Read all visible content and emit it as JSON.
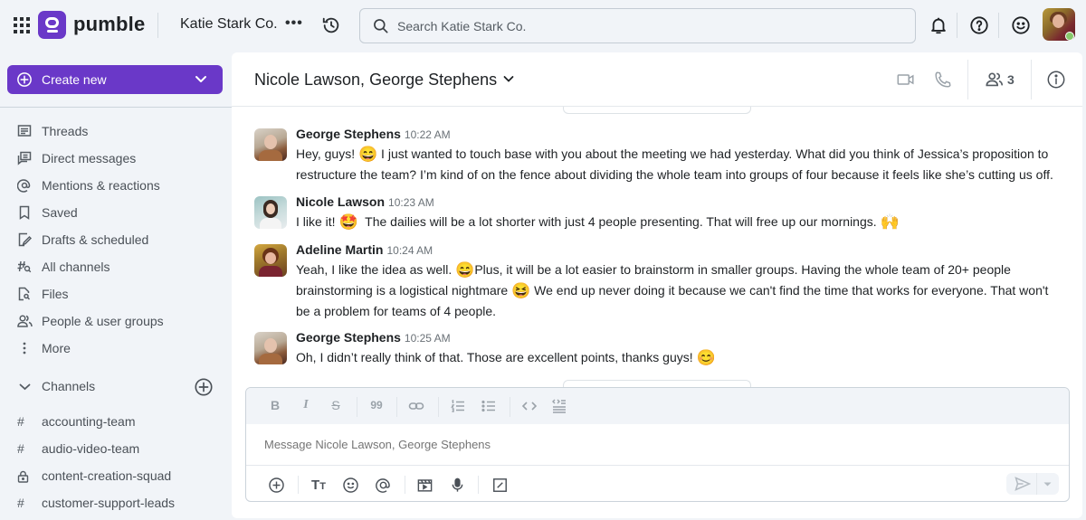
{
  "topbar": {
    "brand": "pumble",
    "workspace_name": "Katie Stark Co.",
    "more_label": "•••",
    "search_placeholder": "Search Katie Stark Co.",
    "icons": [
      "apps-grid-icon",
      "history-icon",
      "search-icon",
      "bell-icon",
      "help-icon",
      "emoji-status-icon"
    ],
    "user_status": "online",
    "brand_color": "#6a38c8"
  },
  "sidebar": {
    "create_new_label": "Create new",
    "nav_items": [
      {
        "label": "Threads",
        "icon": "threads-icon"
      },
      {
        "label": "Direct messages",
        "icon": "direct-messages-icon"
      },
      {
        "label": "Mentions & reactions",
        "icon": "at-icon"
      },
      {
        "label": "Saved",
        "icon": "bookmark-icon"
      },
      {
        "label": "Drafts & scheduled",
        "icon": "draft-icon"
      },
      {
        "label": "All channels",
        "icon": "channel-search-icon"
      },
      {
        "label": "Files",
        "icon": "file-search-icon"
      },
      {
        "label": "People & user groups",
        "icon": "people-icon"
      },
      {
        "label": "More",
        "icon": "more-vertical-icon"
      }
    ],
    "channels_header": "Channels",
    "channels": [
      {
        "name": "accounting-team",
        "type": "public"
      },
      {
        "name": "audio-video-team",
        "type": "public"
      },
      {
        "name": "content-creation-squad",
        "type": "private"
      },
      {
        "name": "customer-support-leads",
        "type": "public"
      }
    ]
  },
  "chat": {
    "title": "Nicole Lawson, George Stephens",
    "member_count": "3",
    "messages": [
      {
        "author": "George Stephens",
        "time": "10:22 AM",
        "parts": [
          "Hey, guys! ",
          "😄",
          " I just wanted to touch base with you about the meeting we had yesterday. What did you think of Jessica’s proposition to restructure the team? I’m kind of on the fence about dividing the whole team into groups of four because it feels like she’s cutting us off."
        ]
      },
      {
        "author": "Nicole Lawson",
        "time": "10:23 AM",
        "parts": [
          "I like it! ",
          "🤩",
          "  The dailies will be a lot shorter with just 4 people presenting. That will free up our mornings. ",
          "🙌",
          ""
        ]
      },
      {
        "author": "Adeline Martin",
        "time": "10:24 AM",
        "parts": [
          "Yeah, I like the idea as well. ",
          "😄",
          "Plus, it will be a lot easier to brainstorm in smaller groups. Having the whole team of 20+ people brainstorming is a logistical nightmare ",
          "😆",
          " We end up never doing it because we can't find the time that works for everyone. That won't be a problem for teams of 4 people."
        ]
      },
      {
        "author": "George Stephens",
        "time": "10:25 AM",
        "parts": [
          "Oh, I didn’t really think of that. Those are excellent points, thanks guys! ",
          "😊",
          ""
        ]
      }
    ]
  },
  "composer": {
    "placeholder": "Message Nicole Lawson, George Stephens",
    "format_buttons": {
      "bold": "B",
      "italic": "I",
      "strike": "S",
      "quote": "99"
    },
    "send_label": "Send"
  }
}
